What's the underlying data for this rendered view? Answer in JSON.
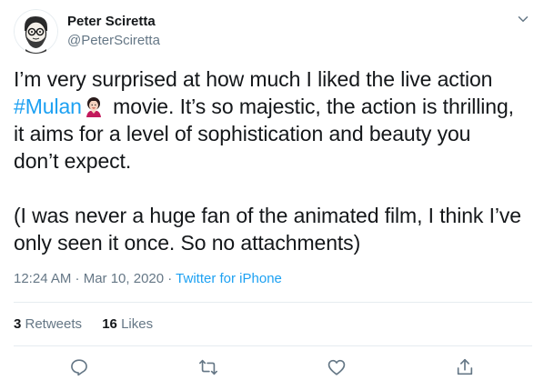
{
  "author": {
    "name": "Peter Sciretta",
    "handle": "@PeterSciretta"
  },
  "tweet": {
    "line1": "I’m very surprised at how much I liked the live action",
    "hashtag": "#Mulan",
    "line2_rest": " movie. It’s so majestic, the action is thrilling,",
    "line3": "it aims for a level of sophistication and beauty you",
    "line4": "don’t expect.",
    "para2_line1": "(I was never a huge fan of the animated film, I think I’ve",
    "para2_line2": "only seen it once. So no attachments)"
  },
  "meta": {
    "time": "12:24 AM · Mar 10, 2020 · ",
    "source": "Twitter for iPhone"
  },
  "stats": {
    "retweets_count": "3",
    "retweets_label": " Retweets",
    "likes_count": "16",
    "likes_label": " Likes"
  },
  "icons": {
    "menu": "chevron-down-icon",
    "reply": "reply-icon",
    "retweet": "retweet-icon",
    "like": "heart-icon",
    "share": "share-icon",
    "hashtag_emoji": "mulan-emoji-icon"
  },
  "colors": {
    "link": "#1da1f2",
    "secondary": "#657786",
    "primary": "#14171a"
  }
}
